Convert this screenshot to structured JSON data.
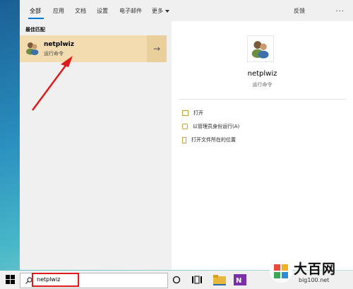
{
  "tabs": [
    "全部",
    "应用",
    "文档",
    "设置",
    "电子邮件",
    "更多"
  ],
  "feedback": "反馈",
  "more_dots": "...",
  "best_match_label": "最佳匹配",
  "best": {
    "title": "netplwiz",
    "subtitle": "运行命令"
  },
  "detail": {
    "title": "netplwiz",
    "subtitle": "运行命令"
  },
  "actions": [
    "打开",
    "以管理员身份运行(A)",
    "打开文件所在的位置"
  ],
  "search": {
    "value": "netplwiz"
  },
  "watermark": {
    "cn": "大百网",
    "url": "big100.net"
  },
  "colors": {
    "highlight": "#f3ddb0",
    "accent": "#0078d7",
    "annotation": "#e01a1a"
  }
}
